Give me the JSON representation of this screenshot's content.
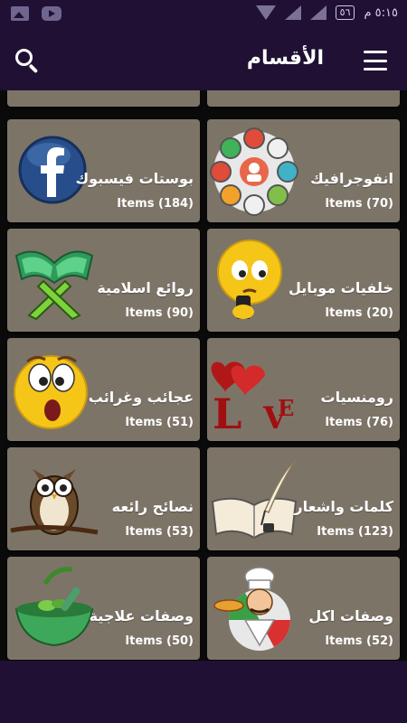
{
  "status_bar": {
    "time": "٥:١٥ م",
    "battery": "٥٦"
  },
  "header": {
    "title": "الأقسام"
  },
  "categories": [
    {
      "name": "انفوجرافيك",
      "count": "Items (70)",
      "icon": "infographic-icon"
    },
    {
      "name": "بوستات فيسبوك",
      "count": "Items (184)",
      "icon": "facebook-icon"
    },
    {
      "name": "خلفيات موبايل",
      "count": "Items (20)",
      "icon": "emoji-phone-icon"
    },
    {
      "name": "روائع اسلامية",
      "count": "Items (90)",
      "icon": "quran-icon"
    },
    {
      "name": "رومنسيات",
      "count": "Items (76)",
      "icon": "love-hearts-icon"
    },
    {
      "name": "عجائب وغرائب",
      "count": "Items (51)",
      "icon": "surprised-emoji-icon"
    },
    {
      "name": "كلمات واشعار",
      "count": "Items (123)",
      "icon": "book-quill-icon"
    },
    {
      "name": "نصائح رائعه",
      "count": "Items (53)",
      "icon": "owl-icon"
    },
    {
      "name": "وصفات اكل",
      "count": "Items (52)",
      "icon": "chef-icon"
    },
    {
      "name": "وصفات علاجية",
      "count": "Items (50)",
      "icon": "mortar-herbs-icon"
    }
  ]
}
